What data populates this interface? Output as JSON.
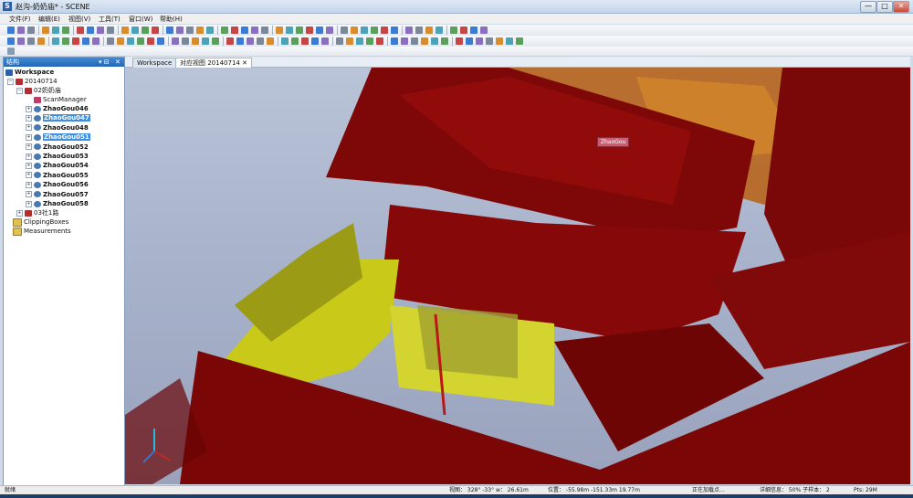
{
  "window": {
    "title": "赵沟-奶奶庙* - SCENE",
    "logo_letter": "S",
    "minimize": "—",
    "maximize": "□",
    "close": "✕"
  },
  "menu": [
    "文件(F)",
    "编辑(E)",
    "视图(V)",
    "工具(T)",
    "窗口(W)",
    "帮助(H)"
  ],
  "panel": {
    "title": "结构",
    "pin": "▾ ⊟",
    "close": "✕"
  },
  "tree": {
    "workspace": "Workspace",
    "project": "20140714",
    "group1": "02奶奶庙",
    "scan_manager": "ScanManager",
    "scans": [
      "ZhaoGou046",
      "ZhaoGou047",
      "ZhaoGou048",
      "ZhaoGou051",
      "ZhaoGou052",
      "ZhaoGou053",
      "ZhaoGou054",
      "ZhaoGou055",
      "ZhaoGou056",
      "ZhaoGou057",
      "ZhaoGou058"
    ],
    "selected_scans": [
      "ZhaoGou047",
      "ZhaoGou051"
    ],
    "group2": "03社1路",
    "clipping": "ClippingBoxes",
    "measurements": "Measurements"
  },
  "tabs": [
    {
      "label": "Workspace",
      "active": false
    },
    {
      "label": "对应视图 20140714",
      "active": true
    }
  ],
  "tab_close": "✕",
  "viewport": {
    "scan_tag": "ZhaoGou"
  },
  "status": {
    "ready": "就绪",
    "view": "视图：  328° -33° w：  26.61m",
    "position": "位置：  -55.98m -151.33m 19.77m",
    "loading": "正在加载点...",
    "detail": "详细信息：  50%   子样本：  2",
    "pts": "Pts: 29M"
  },
  "colors": {
    "accent": "#3f8fde",
    "point_red": "#8b0a0a",
    "point_yellow": "#d8d820",
    "point_orange": "#c06a1a",
    "sky": "#a9b3cc"
  }
}
